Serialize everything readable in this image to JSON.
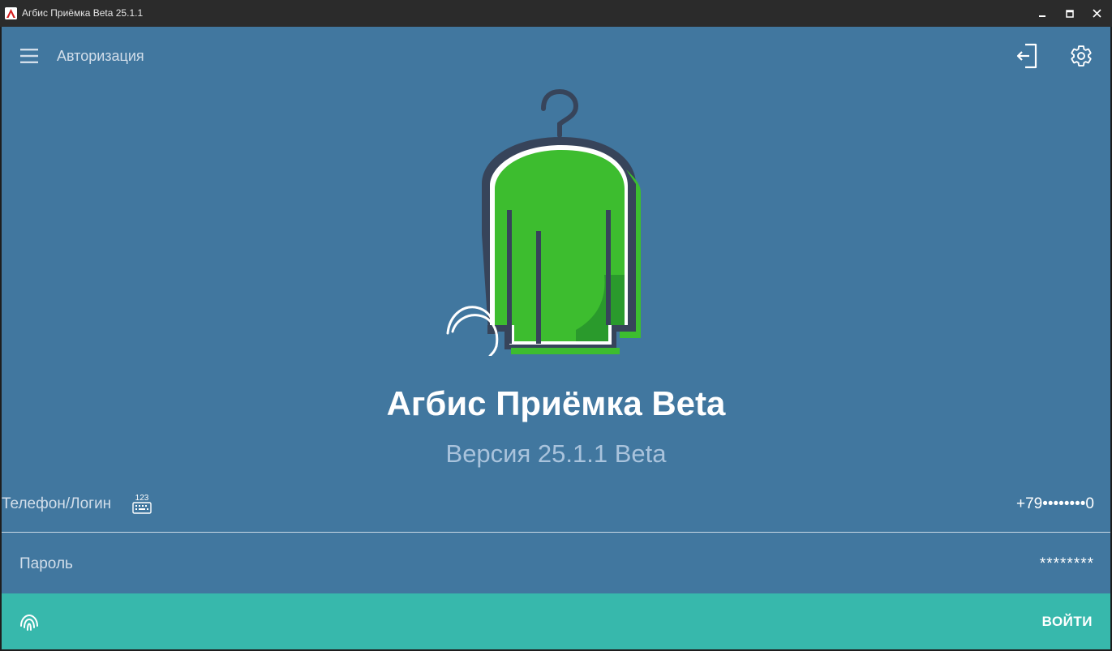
{
  "window": {
    "title": "Агбис Приёмка Beta 25.1.1",
    "icon": "agbis-app-icon",
    "buttons": [
      "minimize-icon",
      "maximize-icon",
      "close-icon"
    ]
  },
  "header": {
    "title": "Авторизация",
    "menu_icon": "hamburger-menu-icon",
    "logout_icon": "logout-icon",
    "settings_icon": "gear-icon"
  },
  "branding": {
    "app_name": "Агбис Приёмка Beta",
    "version": "Версия 25.1.1 Beta"
  },
  "form": {
    "login_label": "Телефон/Логин",
    "keyboard_icon": "numeric-keyboard-icon",
    "keyboard_icon_text": "123",
    "login_value": "+79••••••••0",
    "password_label": "Пароль",
    "password_value": "********"
  },
  "footer": {
    "fingerprint_icon": "fingerprint-icon",
    "login_button": "ВОЙТИ"
  },
  "colors": {
    "background": "#41779f",
    "accent": "#37b8ac",
    "logo_green": "#3dbd2f",
    "logo_outline": "#37445a",
    "titlebar": "#2b2b2b"
  }
}
